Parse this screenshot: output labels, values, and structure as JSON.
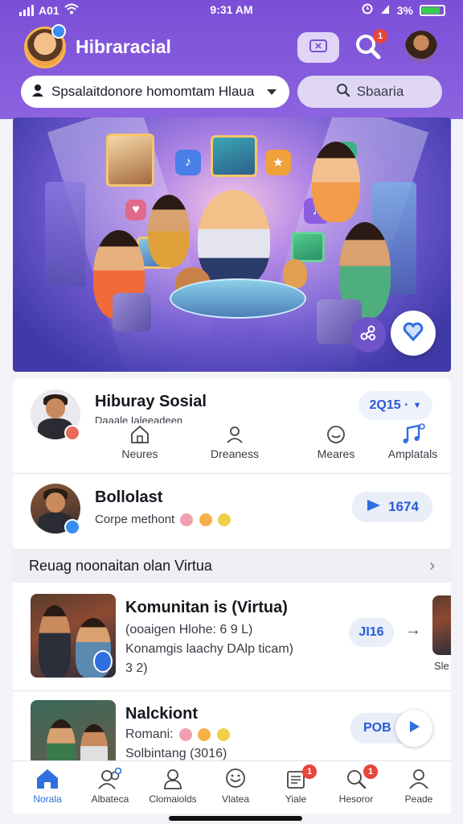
{
  "status": {
    "carrier": "A01",
    "time": "9:31 AM",
    "battery": "3%"
  },
  "header": {
    "title": "Hibraracial",
    "search_badge": "1"
  },
  "dropdown": {
    "value": "Spsalaitdonore homomtam Hlaua"
  },
  "search": {
    "label": "Sbaaria"
  },
  "profile": {
    "name": "Hiburay Sosial",
    "subtitle": "Daaale Ialeeadeen",
    "pill": "2Q15 ∙"
  },
  "tabs": [
    {
      "label": "Neures",
      "icon": "home-icon"
    },
    {
      "label": "Dreaness",
      "icon": "person-icon"
    },
    {
      "label": "Meares",
      "icon": "smile-icon"
    },
    {
      "label": "Amplatals",
      "icon": "music-icon"
    }
  ],
  "post1": {
    "name": "Bollolast",
    "subtitle": "Corpe methont",
    "pill": "1674"
  },
  "section": {
    "title": "Reuag noonaitan olan Virtua"
  },
  "item1": {
    "title": "Komunitan is (Virtua)",
    "line1": "(ooaigen Hlohe: 6 9 L)",
    "line2": "Konamgis laachy DAlp ticam)",
    "line3": "3 2)",
    "pill": "JI16",
    "side_label": "Sle"
  },
  "item2": {
    "title": "Nalckiont",
    "line1": "Romani:",
    "line2": "Solbintang (3016)",
    "pill": "POB"
  },
  "nav": [
    {
      "label": "Norala",
      "icon": "home-icon",
      "badge": ""
    },
    {
      "label": "Albateca",
      "icon": "people-icon",
      "badge": ""
    },
    {
      "label": "Clomaiolds",
      "icon": "person-icon",
      "badge": ""
    },
    {
      "label": "Vlatea",
      "icon": "chat-icon",
      "badge": ""
    },
    {
      "label": "Yiale",
      "icon": "news-icon",
      "badge": "1"
    },
    {
      "label": "Hesoror",
      "icon": "search-icon",
      "badge": "1"
    },
    {
      "label": "Peade",
      "icon": "profile-icon",
      "badge": ""
    }
  ],
  "colors": {
    "primary": "#7a4fd6",
    "accent": "#2f6fe0",
    "badge": "#e8453c"
  }
}
